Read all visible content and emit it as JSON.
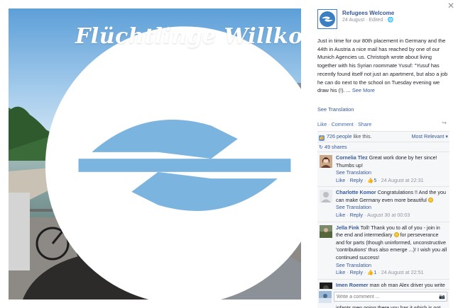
{
  "photo": {
    "overlay_title": "Flüchtlinge Willkommen"
  },
  "close_icon": "✕",
  "post": {
    "page_name": "Refugees Welcome",
    "meta": "24 August · Edited · ",
    "text": "Just in time for our 80th placement in Germany and the 44th in Austria a nice mail has reached by one of our Munich Agencies us. Christoph wrote about living together with his Syrian roommate Yusuf: \"Yusuf has recently found itself not just an apartment, but also a job he can do next to the school on Tuesday evening we draw his (!). ... ",
    "see_more": "See More",
    "see_translation": "See Translation",
    "actions": {
      "like": "Like",
      "comment": "Comment",
      "share": "Share"
    }
  },
  "feedback": {
    "likes_count": "726 people",
    "likes_suffix": " like this.",
    "sort_label": "Most Relevant ▾",
    "shares": "49 shares"
  },
  "comments": [
    {
      "name": "Cornelia Tlez",
      "text": " Great work done by her since! Thumbs up!",
      "translation": "See Translation",
      "like": "Like",
      "reply": "Reply",
      "likes": "5",
      "time": "24 August at 22:31"
    },
    {
      "name": "Charlotte Komor",
      "text": " Congratulations !! And the you can make Germany even more beautiful ",
      "translation": "See Translation",
      "like": "Like",
      "reply": "Reply",
      "time": "August 30 at 00:03"
    },
    {
      "name": "Jella Fink",
      "text": " Toll! Thank you to all of you - join in the end and intermediary ",
      "text2": " for perseverance and for parts (though uninformed, unconstructive 'contributions' thus also emerge ...)! I wish you all continued success!",
      "translation": "See Translation",
      "like": "Like",
      "reply": "Reply",
      "likes": "1",
      "time": "24 August at 22:51"
    },
    {
      "name": "Imen Roemer",
      "text": " man oh man Alex driver you write them to remain where they are Have you ever made you think about how the women children infants men going there you has it which is not"
    }
  ],
  "composer": {
    "placeholder": "Write a comment ..."
  },
  "colors": {
    "link": "#365899",
    "accent": "#4267b2",
    "panel_bg": "#f6f7f9"
  }
}
